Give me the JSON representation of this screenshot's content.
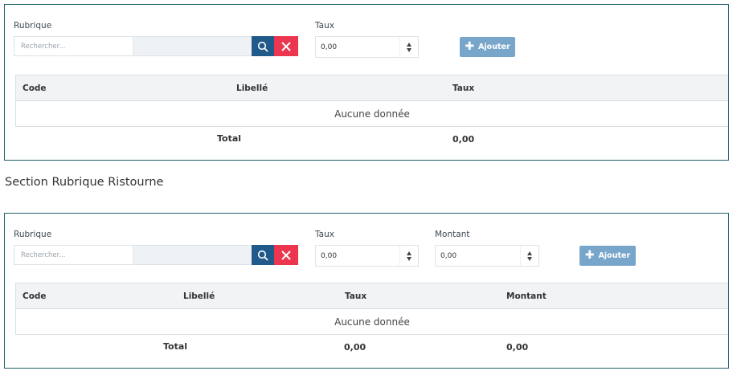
{
  "section1": {
    "rubrique_label": "Rubrique",
    "search_placeholder": "Rechercher...",
    "taux_label": "Taux",
    "taux_value": "0,00",
    "add_label": "Ajouter",
    "table": {
      "columns": [
        "Code",
        "Libellé",
        "Taux"
      ],
      "empty_text": "Aucune donnée",
      "total_label": "Total",
      "totals": {
        "taux": "0,00"
      }
    }
  },
  "section2": {
    "title": "Section Rubrique Ristourne",
    "rubrique_label": "Rubrique",
    "search_placeholder": "Rechercher...",
    "taux_label": "Taux",
    "taux_value": "0,00",
    "montant_label": "Montant",
    "montant_value": "0,00",
    "add_label": "Ajouter",
    "table": {
      "columns": [
        "Code",
        "Libellé",
        "Taux",
        "Montant"
      ],
      "empty_text": "Aucune donnée",
      "total_label": "Total",
      "totals": {
        "taux": "0,00",
        "montant": "0,00"
      }
    }
  },
  "colors": {
    "panel_border": "#1f5f6b",
    "search_button": "#205a8a",
    "clear_button": "#ec3650",
    "add_button": "#78a6cb"
  }
}
